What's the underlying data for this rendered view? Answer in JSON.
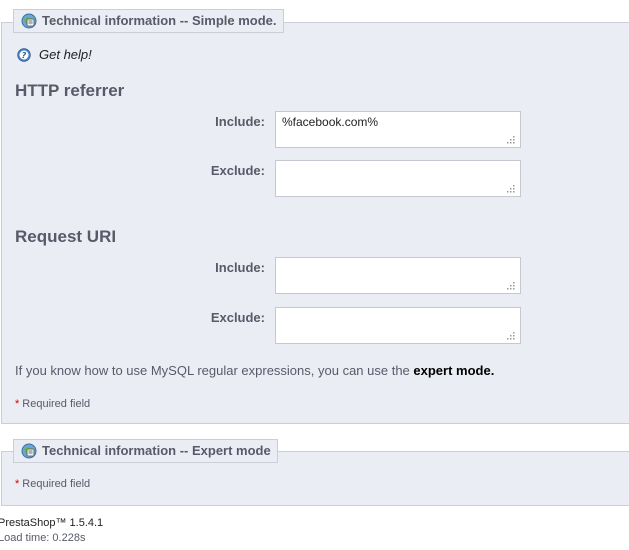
{
  "simple_mode": {
    "legend": "Technical information -- Simple mode.",
    "help_link": "Get help!",
    "http_referrer": {
      "title": "HTTP referrer",
      "include_label": "Include:",
      "include_value": "%facebook.com%",
      "exclude_label": "Exclude:",
      "exclude_value": ""
    },
    "request_uri": {
      "title": "Request URI",
      "include_label": "Include:",
      "include_value": "",
      "exclude_label": "Exclude:",
      "exclude_value": ""
    },
    "info_text": "If you know how to use MySQL regular expressions, you can use the",
    "expert_link": "expert mode.",
    "required_star": "*",
    "required_text": "Required field"
  },
  "expert_mode": {
    "legend": "Technical information -- Expert mode",
    "required_star": "*",
    "required_text": "Required field"
  },
  "footer": {
    "version": "PrestaShop™ 1.5.4.1",
    "load_time": "Load time: 0.228s"
  },
  "colors": {
    "panel_bg": "#ebedf4",
    "border": "#ccced7",
    "text": "#585a69",
    "required_star": "#cc0000"
  },
  "icons": {
    "legend": "technical-info-icon",
    "help": "help-icon",
    "resize": "resize-grip-icon"
  }
}
